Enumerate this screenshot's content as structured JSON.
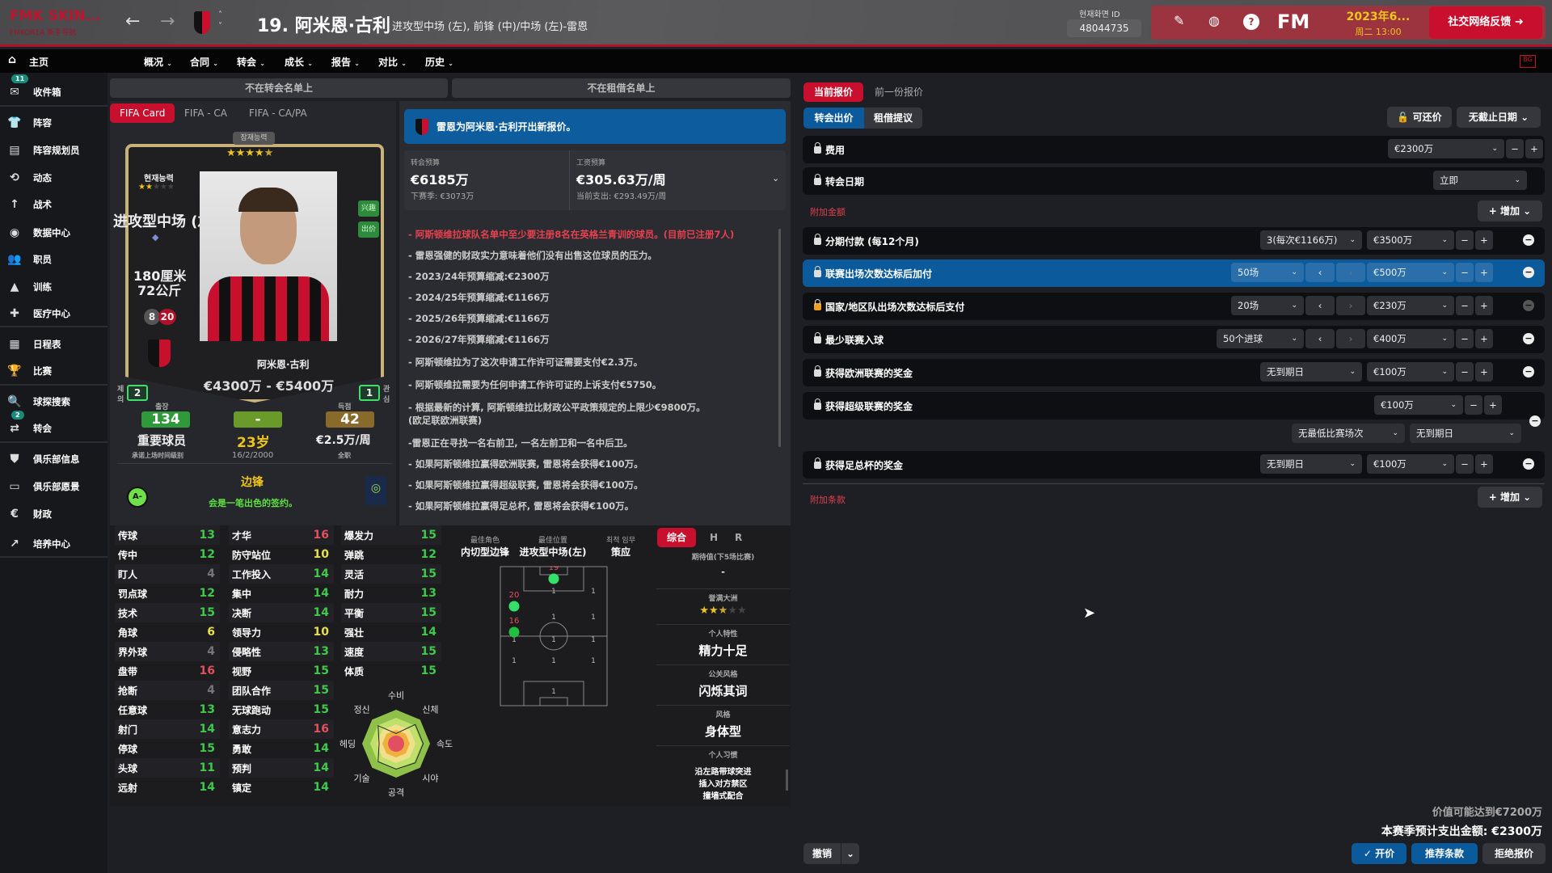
{
  "topbar": {
    "brand": "FMK SKIN...",
    "brand_sub": "FMKOREA 新手导航",
    "title": "19. 阿米恩·古利",
    "subtitle": "进攻型中场 (左), 前锋 (中)/中场 (左)-雷恩",
    "screen_id_label": "현재화면 ID",
    "screen_id": "48044735",
    "fm_logo": "FM",
    "date": "2023年6...",
    "time": "周二 13:00",
    "social": "社交网络反馈",
    "icons": [
      "back-icon",
      "forward-icon",
      "pencil-icon",
      "globe-icon",
      "help-icon"
    ]
  },
  "nav": {
    "home": "主页",
    "items": [
      "概况",
      "合同",
      "转会",
      "成长",
      "报告",
      "对比",
      "历史"
    ]
  },
  "sidebar": [
    {
      "label": "收件箱",
      "icon": "✉",
      "badge": "11"
    },
    {
      "label": "阵容",
      "icon": "👕"
    },
    {
      "label": "阵容规划员",
      "icon": "▤"
    },
    {
      "label": "动态",
      "icon": "⟲"
    },
    {
      "label": "战术",
      "icon": "↑"
    },
    {
      "label": "数据中心",
      "icon": "◉"
    },
    {
      "label": "职员",
      "icon": "👥"
    },
    {
      "label": "训练",
      "icon": "▲"
    },
    {
      "label": "医疗中心",
      "icon": "✚"
    },
    {
      "label": "日程表",
      "icon": "▦"
    },
    {
      "label": "比赛",
      "icon": "🏆"
    },
    {
      "label": "球探搜索",
      "icon": "🔍"
    },
    {
      "label": "转会",
      "icon": "⇄",
      "badge": "2"
    },
    {
      "label": "俱乐部信息",
      "icon": "⛊"
    },
    {
      "label": "俱乐部愿景",
      "icon": "▭"
    },
    {
      "label": "财政",
      "icon": "€"
    },
    {
      "label": "培养中心",
      "icon": "↗"
    }
  ],
  "status": {
    "transfer_list": "不在转会名单上",
    "loan_list": "不在租借名单上"
  },
  "card_tabs": [
    "FIFA Card",
    "FIFA - CA",
    "FIFA - CA/PA"
  ],
  "card": {
    "potential_label": "잠재능력",
    "potential_stars": 4.5,
    "current_label": "현재능력",
    "current_stars": 2,
    "position": "进攻型中场 (左)",
    "height": "180厘米",
    "weight": "72公斤",
    "num1": "8",
    "num2": "20",
    "tag_interest": "兴趣",
    "tag_bid": "出价",
    "name": "阿米恩·古利",
    "value": "€4300万 - €5400万",
    "offers_label": "제의",
    "offers": "2",
    "interest_label": "관심",
    "interest": "1",
    "apps_label": "출장",
    "apps": "134",
    "mid_stat": "-",
    "goals_label": "득점",
    "goals": "42",
    "role": "重要球员",
    "role_sub": "承诺上场时间级别",
    "age": "23岁",
    "dob": "16/2/2000",
    "wage": "€2.5万/周",
    "wage_sub": "全职",
    "scout_grade": "A-",
    "scout_pos": "边锋",
    "scout_text": "会是一笔出色的签约。"
  },
  "banner": "雷恩为阿米恩·古利开出新报价。",
  "budget": {
    "transfer_label": "转会预算",
    "transfer": "€6185万",
    "transfer_next": "下赛季: €3073万",
    "wage_label": "工资预算",
    "wage": "€305.63万/周",
    "wage_current": "当前支出: €293.49万/周"
  },
  "notes": [
    {
      "t": "- 阿斯顿维拉球队名单中至少要注册8名在英格兰青训的球员。(目前已注册7人)",
      "warn": true
    },
    {
      "t": "- 雷恩强健的财政实力意味着他们没有出售这位球员的压力。"
    },
    {
      "t": "- 2023/24年预算缩减:€2300万"
    },
    {
      "t": "- 2024/25年预算缩减:€1166万"
    },
    {
      "t": "- 2025/26年预算缩减:€1166万"
    },
    {
      "t": "- 2026/27年预算缩减:€1166万"
    },
    {
      "t": "- 阿斯顿维拉为了这次申请工作许可证需要支付€2.3万。"
    },
    {
      "t": "- 阿斯顿维拉需要为任何申请工作许可证的上诉支付€5750。"
    },
    {
      "t": "- 根据最新的计算, 阿斯顿维拉比财政公平政策规定的上限少€9800万。"
    },
    {
      "t": "(欧足联欧洲联赛)"
    },
    {
      "t": "-雷恩正在寻找一名右前卫, 一名左前卫和一名中后卫。"
    },
    {
      "t": "- 如果阿斯顿维拉赢得欧洲联赛, 雷恩将会获得€100万。"
    },
    {
      "t": "- 如果阿斯顿维拉赢得超级联赛, 雷恩将会获得€100万。"
    },
    {
      "t": "- 如果阿斯顿维拉赢得足总杯, 雷恩将会获得€100万。"
    }
  ],
  "attributes": [
    [
      [
        "传球",
        13
      ],
      [
        "传中",
        12
      ],
      [
        "盯人",
        4
      ],
      [
        "罚点球",
        12
      ],
      [
        "技术",
        15
      ],
      [
        "角球",
        6
      ],
      [
        "界外球",
        4
      ],
      [
        "盘带",
        16
      ],
      [
        "抢断",
        4
      ],
      [
        "任意球",
        13
      ],
      [
        "射门",
        14
      ],
      [
        "停球",
        15
      ],
      [
        "头球",
        11
      ],
      [
        "远射",
        14
      ]
    ],
    [
      [
        "才华",
        16
      ],
      [
        "防守站位",
        10
      ],
      [
        "工作投入",
        14
      ],
      [
        "集中",
        14
      ],
      [
        "决断",
        14
      ],
      [
        "领导力",
        10
      ],
      [
        "侵略性",
        13
      ],
      [
        "视野",
        15
      ],
      [
        "团队合作",
        15
      ],
      [
        "无球跑动",
        15
      ],
      [
        "意志力",
        16
      ],
      [
        "勇敢",
        14
      ],
      [
        "预判",
        14
      ],
      [
        "镇定",
        14
      ]
    ],
    [
      [
        "爆发力",
        15
      ],
      [
        "弹跳",
        12
      ],
      [
        "灵活",
        15
      ],
      [
        "耐力",
        13
      ],
      [
        "平衡",
        15
      ],
      [
        "强壮",
        14
      ],
      [
        "速度",
        15
      ],
      [
        "体质",
        15
      ]
    ]
  ],
  "attr_colors": {
    "high": "#e0505e",
    "good": "#3ec94a",
    "mid": "#e8e04a",
    "low": "#777777"
  },
  "radar": [
    {
      "label": "수비",
      "value": 0.3
    },
    {
      "label": "신체",
      "value": 0.8
    },
    {
      "label": "속도",
      "value": 0.8
    },
    {
      "label": "시야",
      "value": 0.8
    },
    {
      "label": "공격",
      "value": 0.75
    },
    {
      "label": "기술",
      "value": 0.75
    },
    {
      "label": "헤딩",
      "value": 0.5
    },
    {
      "label": "정신",
      "value": 0.75
    }
  ],
  "best": {
    "role_label": "最佳角色",
    "role": "内切型边锋",
    "pos_label": "最佳位置",
    "pos": "进攻型中场(左)",
    "duty_label": "최적 임무",
    "duty": "策应"
  },
  "pitch": {
    "highlight": [
      {
        "n": "19",
        "pos": "AMC"
      },
      {
        "n": "20",
        "pos": "AML"
      },
      {
        "n": "16",
        "pos": "ML"
      }
    ],
    "ones": "1"
  },
  "info_tabs": [
    "综合",
    "H",
    "R"
  ],
  "info": [
    {
      "label": "期待值(下5场比赛)",
      "value": "-"
    },
    {
      "label": "誉满大洲",
      "stars": 2.5
    },
    {
      "label": "个人特性",
      "value": "精力十足"
    },
    {
      "label": "公关风格",
      "value": "闪烁其词"
    },
    {
      "label": "风格",
      "value": "身体型"
    },
    {
      "label": "个人习惯",
      "list": [
        "沿左路带球突进",
        "插入对方禁区",
        "撞墙式配合"
      ]
    }
  ],
  "offer": {
    "tabs": [
      "当前报价",
      "前一份报价"
    ],
    "type_tabs": [
      "转会出价",
      "租借提议"
    ],
    "negotiable": "可还价",
    "deadline": "无截止日期",
    "fee_label": "费用",
    "fee": "€2300万",
    "date_label": "转会日期",
    "date": "立即",
    "add_fee_label": "附加金额",
    "add_clause_label": "附加条款",
    "add": "增加",
    "rows": [
      {
        "label": "分期付款 (每12个月)",
        "opt": "3(每次€1166万)",
        "amount": "€3500万"
      },
      {
        "label": "联赛出场次数达标后加付",
        "opt": "50场",
        "stepper": true,
        "amount": "€500万",
        "selected": true
      },
      {
        "label": "国家/地区队出场次数达标后支付",
        "opt": "20场",
        "stepper": true,
        "amount": "€230万",
        "locked": true
      },
      {
        "label": "最少联赛入球",
        "opt": "50个进球",
        "stepper": true,
        "amount": "€400万"
      },
      {
        "label": "获得欧洲联赛的奖金",
        "opt": "无到期日",
        "amount": "€100万"
      }
    ],
    "premier": {
      "label": "获得超级联赛的奖金",
      "amount": "€100万",
      "opt1": "无最低比赛场次",
      "opt2": "无到期日"
    },
    "facup": {
      "label": "获得足总杯的奖金",
      "opt": "无到期日",
      "amount": "€100万"
    },
    "potential_value": "价值可能达到€7200万",
    "season_spend": "本赛季预计支出金额: €2300万",
    "undo": "撤销",
    "propose": "开价",
    "suggest": "推荐条款",
    "reject": "拒绝报价"
  },
  "colors": {
    "accent_red": "#c8102e",
    "accent_blue": "#0b5a9c",
    "lock_orange": "#f0a020"
  }
}
